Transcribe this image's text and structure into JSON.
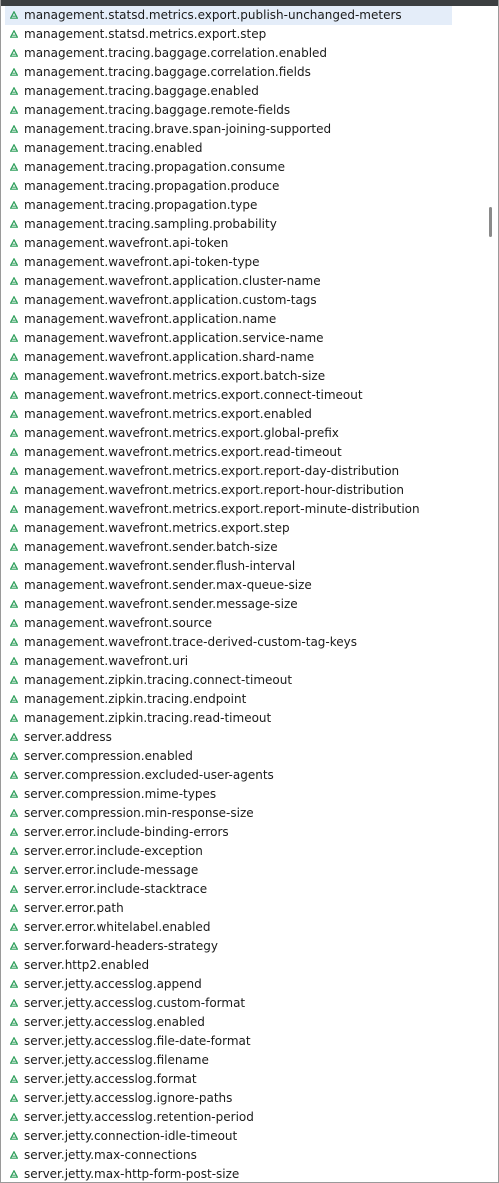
{
  "items": [
    {
      "label": "management.statsd.metrics.export.publish-unchanged-meters",
      "selected": true
    },
    {
      "label": "management.statsd.metrics.export.step"
    },
    {
      "label": "management.tracing.baggage.correlation.enabled"
    },
    {
      "label": "management.tracing.baggage.correlation.fields"
    },
    {
      "label": "management.tracing.baggage.enabled"
    },
    {
      "label": "management.tracing.baggage.remote-fields"
    },
    {
      "label": "management.tracing.brave.span-joining-supported"
    },
    {
      "label": "management.tracing.enabled"
    },
    {
      "label": "management.tracing.propagation.consume"
    },
    {
      "label": "management.tracing.propagation.produce"
    },
    {
      "label": "management.tracing.propagation.type"
    },
    {
      "label": "management.tracing.sampling.probability"
    },
    {
      "label": "management.wavefront.api-token"
    },
    {
      "label": "management.wavefront.api-token-type"
    },
    {
      "label": "management.wavefront.application.cluster-name"
    },
    {
      "label": "management.wavefront.application.custom-tags"
    },
    {
      "label": "management.wavefront.application.name"
    },
    {
      "label": "management.wavefront.application.service-name"
    },
    {
      "label": "management.wavefront.application.shard-name"
    },
    {
      "label": "management.wavefront.metrics.export.batch-size"
    },
    {
      "label": "management.wavefront.metrics.export.connect-timeout"
    },
    {
      "label": "management.wavefront.metrics.export.enabled"
    },
    {
      "label": "management.wavefront.metrics.export.global-prefix"
    },
    {
      "label": "management.wavefront.metrics.export.read-timeout"
    },
    {
      "label": "management.wavefront.metrics.export.report-day-distribution"
    },
    {
      "label": "management.wavefront.metrics.export.report-hour-distribution"
    },
    {
      "label": "management.wavefront.metrics.export.report-minute-distribution"
    },
    {
      "label": "management.wavefront.metrics.export.step"
    },
    {
      "label": "management.wavefront.sender.batch-size"
    },
    {
      "label": "management.wavefront.sender.flush-interval"
    },
    {
      "label": "management.wavefront.sender.max-queue-size"
    },
    {
      "label": "management.wavefront.sender.message-size"
    },
    {
      "label": "management.wavefront.source"
    },
    {
      "label": "management.wavefront.trace-derived-custom-tag-keys"
    },
    {
      "label": "management.wavefront.uri"
    },
    {
      "label": "management.zipkin.tracing.connect-timeout"
    },
    {
      "label": "management.zipkin.tracing.endpoint"
    },
    {
      "label": "management.zipkin.tracing.read-timeout"
    },
    {
      "label": "server.address"
    },
    {
      "label": "server.compression.enabled"
    },
    {
      "label": "server.compression.excluded-user-agents"
    },
    {
      "label": "server.compression.mime-types"
    },
    {
      "label": "server.compression.min-response-size"
    },
    {
      "label": "server.error.include-binding-errors"
    },
    {
      "label": "server.error.include-exception"
    },
    {
      "label": "server.error.include-message"
    },
    {
      "label": "server.error.include-stacktrace"
    },
    {
      "label": "server.error.path"
    },
    {
      "label": "server.error.whitelabel.enabled"
    },
    {
      "label": "server.forward-headers-strategy"
    },
    {
      "label": "server.http2.enabled"
    },
    {
      "label": "server.jetty.accesslog.append"
    },
    {
      "label": "server.jetty.accesslog.custom-format"
    },
    {
      "label": "server.jetty.accesslog.enabled"
    },
    {
      "label": "server.jetty.accesslog.file-date-format"
    },
    {
      "label": "server.jetty.accesslog.filename"
    },
    {
      "label": "server.jetty.accesslog.format"
    },
    {
      "label": "server.jetty.accesslog.ignore-paths"
    },
    {
      "label": "server.jetty.accesslog.retention-period"
    },
    {
      "label": "server.jetty.connection-idle-timeout"
    },
    {
      "label": "server.jetty.max-connections"
    },
    {
      "label": "server.jetty.max-http-form-post-size"
    }
  ],
  "icon": "property-triangle-icon",
  "colors": {
    "icon": "#2e9e5b",
    "selected_bg": "#e4edf9",
    "text": "#1a1a1a",
    "header": "#3c3f41"
  }
}
